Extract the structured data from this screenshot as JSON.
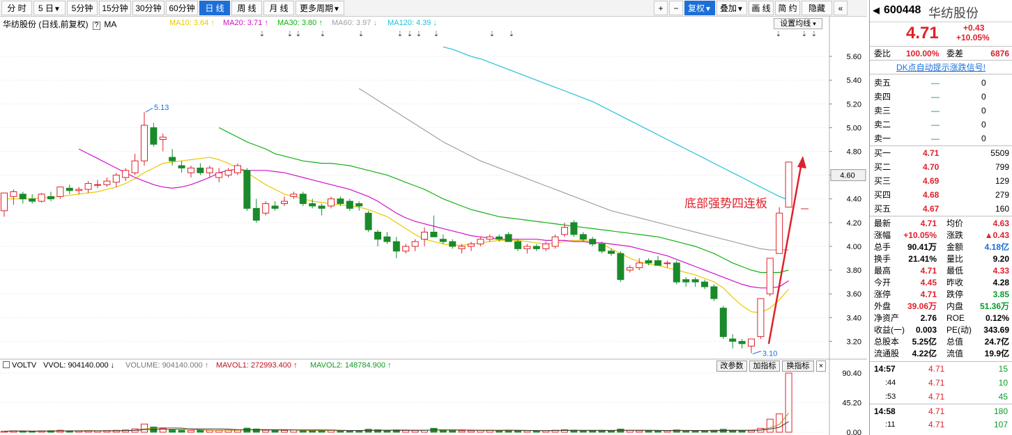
{
  "toolbar": {
    "left_buttons": [
      {
        "label": "分 时",
        "active": false
      },
      {
        "label": "5 日",
        "caret": true,
        "active": false
      },
      {
        "label": "5分钟",
        "active": false
      },
      {
        "label": "15分钟",
        "active": false
      },
      {
        "label": "30分钟",
        "active": false
      },
      {
        "label": "60分钟",
        "active": false
      },
      {
        "label": "日 线",
        "active": true
      },
      {
        "label": "周 线",
        "active": false
      },
      {
        "label": "月 线",
        "active": false
      },
      {
        "label": "更多周期",
        "caret": true,
        "active": false
      }
    ],
    "right_buttons": [
      {
        "label": "+",
        "active": false
      },
      {
        "label": "−",
        "active": false
      },
      {
        "label": "复权",
        "caret": true,
        "active": true
      },
      {
        "label": "叠加",
        "caret": true,
        "active": false
      },
      {
        "label": "画 线",
        "active": false
      },
      {
        "label": "简 约",
        "active": false
      },
      {
        "label": "隐藏",
        "active": false
      },
      {
        "label": "«",
        "active": false
      }
    ]
  },
  "chart": {
    "title": "华纺股份 (日线,前复权)",
    "help": "?",
    "ma_label": "MA",
    "ma_legend": [
      {
        "text": "MA10: 3.64 ↑",
        "color": "#e8c800"
      },
      {
        "text": "MA20: 3.71 ↑",
        "color": "#d010c8"
      },
      {
        "text": "MA30: 3.80 ↑",
        "color": "#10b010"
      },
      {
        "text": "MA60: 3.97 ↓",
        "color": "#a0a0a0"
      },
      {
        "text": "MA120: 4.39 ↓",
        "color": "#20c0d8"
      }
    ],
    "set_ma": "设置均线",
    "annotation": "底部强势四连板",
    "high_label": "5.13",
    "low_label": "3.10",
    "price_tag": "4.60",
    "y_ticks": [
      "5.60",
      "5.40",
      "5.20",
      "5.00",
      "4.80",
      "4.60",
      "4.40",
      "4.20",
      "4.00",
      "3.80",
      "3.60",
      "3.40",
      "3.20"
    ],
    "vol_ticks": [
      "90.40",
      "45.20",
      "0.00"
    ]
  },
  "chart_data": {
    "type": "candlestick",
    "ylim": [
      3.05,
      5.7
    ],
    "candles": [
      [
        4.3,
        4.45,
        4.25,
        4.45
      ],
      [
        4.42,
        4.48,
        4.35,
        4.46
      ],
      [
        4.44,
        4.46,
        4.36,
        4.4
      ],
      [
        4.4,
        4.44,
        4.36,
        4.38
      ],
      [
        4.38,
        4.45,
        4.37,
        4.44
      ],
      [
        4.42,
        4.46,
        4.38,
        4.4
      ],
      [
        4.42,
        4.5,
        4.4,
        4.5
      ],
      [
        4.49,
        4.52,
        4.44,
        4.47
      ],
      [
        4.47,
        4.5,
        4.44,
        4.48
      ],
      [
        4.48,
        4.55,
        4.45,
        4.53
      ],
      [
        4.52,
        4.56,
        4.49,
        4.52
      ],
      [
        4.52,
        4.58,
        4.5,
        4.55
      ],
      [
        4.54,
        4.62,
        4.5,
        4.6
      ],
      [
        4.58,
        4.66,
        4.55,
        4.64
      ],
      [
        4.62,
        4.78,
        4.6,
        4.72
      ],
      [
        4.72,
        5.13,
        4.68,
        5.02
      ],
      [
        5.0,
        5.04,
        4.84,
        4.86
      ],
      [
        4.9,
        4.95,
        4.8,
        4.92
      ],
      [
        4.75,
        4.82,
        4.68,
        4.72
      ],
      [
        4.68,
        4.72,
        4.62,
        4.66
      ],
      [
        4.62,
        4.68,
        4.58,
        4.66
      ],
      [
        4.66,
        4.7,
        4.6,
        4.62
      ],
      [
        4.62,
        4.68,
        4.58,
        4.66
      ],
      [
        4.58,
        4.66,
        4.54,
        4.62
      ],
      [
        4.6,
        4.66,
        4.58,
        4.64
      ],
      [
        4.62,
        4.7,
        4.6,
        4.68
      ],
      [
        4.64,
        4.66,
        4.3,
        4.32
      ],
      [
        4.32,
        4.4,
        4.2,
        4.22
      ],
      [
        4.28,
        4.38,
        4.26,
        4.36
      ],
      [
        4.34,
        4.38,
        4.3,
        4.32
      ],
      [
        4.36,
        4.42,
        4.34,
        4.38
      ],
      [
        4.42,
        4.46,
        4.4,
        4.44
      ],
      [
        4.44,
        4.46,
        4.34,
        4.36
      ],
      [
        4.36,
        4.4,
        4.32,
        4.34
      ],
      [
        4.34,
        4.36,
        4.26,
        4.32
      ],
      [
        4.34,
        4.42,
        4.32,
        4.4
      ],
      [
        4.4,
        4.42,
        4.34,
        4.36
      ],
      [
        4.38,
        4.4,
        4.3,
        4.32
      ],
      [
        4.36,
        4.38,
        4.3,
        4.34
      ],
      [
        4.28,
        4.3,
        4.12,
        4.14
      ],
      [
        4.12,
        4.14,
        4.0,
        4.06
      ],
      [
        4.08,
        4.12,
        4.02,
        4.04
      ],
      [
        4.04,
        4.08,
        3.9,
        3.96
      ],
      [
        3.96,
        4.02,
        3.94,
        4.0
      ],
      [
        4.0,
        4.06,
        3.96,
        4.04
      ],
      [
        4.06,
        4.16,
        4.0,
        4.12
      ],
      [
        4.12,
        4.26,
        4.1,
        4.08
      ],
      [
        4.06,
        4.1,
        4.02,
        4.04
      ],
      [
        4.04,
        4.06,
        3.98,
        4.0
      ],
      [
        3.98,
        4.02,
        3.94,
        4.0
      ],
      [
        4.0,
        4.04,
        3.96,
        4.02
      ],
      [
        4.02,
        4.08,
        4.0,
        4.06
      ],
      [
        4.06,
        4.1,
        4.04,
        4.08
      ],
      [
        4.08,
        4.1,
        4.04,
        4.06
      ],
      [
        4.1,
        4.12,
        4.04,
        4.04
      ],
      [
        4.04,
        4.06,
        3.96,
        3.98
      ],
      [
        3.98,
        4.02,
        3.94,
        4.0
      ],
      [
        4.0,
        4.02,
        3.96,
        3.98
      ],
      [
        3.98,
        4.04,
        3.96,
        4.02
      ],
      [
        4.0,
        4.1,
        3.98,
        4.08
      ],
      [
        4.1,
        4.2,
        4.08,
        4.16
      ],
      [
        4.2,
        4.22,
        4.08,
        4.1
      ],
      [
        4.1,
        4.12,
        4.04,
        4.06
      ],
      [
        4.06,
        4.08,
        4.0,
        4.02
      ],
      [
        4.02,
        4.04,
        3.94,
        3.96
      ],
      [
        3.96,
        3.98,
        3.92,
        3.94
      ],
      [
        3.94,
        3.96,
        3.7,
        3.72
      ],
      [
        3.8,
        3.84,
        3.78,
        3.82
      ],
      [
        3.82,
        3.9,
        3.8,
        3.86
      ],
      [
        3.88,
        3.9,
        3.84,
        3.86
      ],
      [
        3.88,
        3.92,
        3.84,
        3.84
      ],
      [
        3.86,
        3.88,
        3.82,
        3.86
      ],
      [
        3.86,
        3.88,
        3.68,
        3.7
      ],
      [
        3.72,
        3.74,
        3.66,
        3.7
      ],
      [
        3.72,
        3.74,
        3.66,
        3.7
      ],
      [
        3.7,
        3.72,
        3.64,
        3.66
      ],
      [
        3.66,
        3.68,
        3.54,
        3.56
      ],
      [
        3.48,
        3.5,
        3.22,
        3.24
      ],
      [
        3.22,
        3.26,
        3.14,
        3.2
      ],
      [
        3.2,
        3.22,
        3.14,
        3.18
      ],
      [
        3.16,
        3.22,
        3.1,
        3.22
      ],
      [
        3.24,
        3.56,
        3.22,
        3.56
      ],
      [
        3.6,
        3.9,
        3.58,
        3.9
      ],
      [
        3.94,
        4.33,
        3.94,
        4.28
      ],
      [
        4.33,
        4.71,
        4.33,
        4.71
      ]
    ],
    "ma": [
      {
        "name": "MA10",
        "color": "#e8c800",
        "values": [
          4.4,
          4.4,
          4.4,
          4.4,
          4.41,
          4.41,
          4.42,
          4.43,
          4.44,
          4.45,
          4.46,
          4.48,
          4.5,
          4.53,
          4.57,
          4.62,
          4.66,
          4.7,
          4.71,
          4.72,
          4.73,
          4.74,
          4.75,
          4.73,
          4.7,
          4.66,
          4.62,
          4.57,
          4.52,
          4.48,
          4.44,
          4.42,
          4.4,
          4.38,
          4.37,
          4.36,
          4.35,
          4.34,
          4.33,
          4.31,
          4.28,
          4.25,
          4.2,
          4.15,
          4.1,
          4.06,
          4.04,
          4.02,
          4.01,
          4.01,
          4.02,
          4.03,
          4.04,
          4.05,
          4.05,
          4.05,
          4.04,
          4.03,
          4.02,
          4.03,
          4.04,
          4.05,
          4.05,
          4.04,
          4.02,
          3.98,
          3.94,
          3.9,
          3.87,
          3.85,
          3.84,
          3.82,
          3.8,
          3.78,
          3.76,
          3.73,
          3.7,
          3.65,
          3.57,
          3.5,
          3.45,
          3.44,
          3.48,
          3.55,
          3.64
        ]
      },
      {
        "name": "MA20",
        "color": "#d010c8",
        "values": [
          4.82,
          4.78,
          4.74,
          4.7,
          4.66,
          4.62,
          4.58,
          4.55,
          4.52,
          4.5,
          4.49,
          4.5,
          4.52,
          4.55,
          4.58,
          4.62,
          4.64,
          4.65,
          4.64,
          4.64,
          4.64,
          4.63,
          4.62,
          4.6,
          4.58,
          4.56,
          4.54,
          4.52,
          4.5,
          4.48,
          4.45,
          4.42,
          4.38,
          4.33,
          4.28,
          4.24,
          4.21,
          4.19,
          4.17,
          4.15,
          4.13,
          4.11,
          4.09,
          4.08,
          4.07,
          4.06,
          4.06,
          4.06,
          4.06,
          4.06,
          4.05,
          4.05,
          4.05,
          4.04,
          4.04,
          4.03,
          4.03,
          4.02,
          4.01,
          4.0,
          3.98,
          3.96,
          3.94,
          3.92,
          3.89,
          3.86,
          3.83,
          3.8,
          3.77,
          3.74,
          3.71,
          3.68,
          3.66,
          3.65,
          3.65,
          3.66,
          3.71
        ]
      },
      {
        "name": "MA30",
        "color": "#10b010",
        "values": [
          5.0,
          4.96,
          4.92,
          4.88,
          4.85,
          4.82,
          4.78,
          4.76,
          4.74,
          4.72,
          4.71,
          4.7,
          4.7,
          4.69,
          4.68,
          4.66,
          4.64,
          4.62,
          4.6,
          4.57,
          4.54,
          4.51,
          4.48,
          4.44,
          4.4,
          4.37,
          4.34,
          4.31,
          4.29,
          4.27,
          4.25,
          4.24,
          4.23,
          4.22,
          4.21,
          4.2,
          4.19,
          4.18,
          4.17,
          4.16,
          4.15,
          4.14,
          4.13,
          4.12,
          4.11,
          4.1,
          4.09,
          4.08,
          4.06,
          4.04,
          4.02,
          4.0,
          3.97,
          3.94,
          3.9,
          3.86,
          3.83,
          3.8,
          3.78,
          3.78,
          3.78,
          3.8
        ]
      },
      {
        "name": "MA60",
        "color": "#a0a0a0",
        "values": [
          5.33,
          5.28,
          5.23,
          5.18,
          5.13,
          5.08,
          5.03,
          4.98,
          4.93,
          4.88,
          4.84,
          4.8,
          4.76,
          4.72,
          4.69,
          4.66,
          4.63,
          4.6,
          4.57,
          4.54,
          4.51,
          4.48,
          4.45,
          4.42,
          4.39,
          4.36,
          4.33,
          4.3,
          4.28,
          4.26,
          4.24,
          4.22,
          4.2,
          4.18,
          4.16,
          4.14,
          4.12,
          4.1,
          4.08,
          4.06,
          4.04,
          4.02,
          4.0,
          3.98,
          3.97,
          3.97,
          3.97
        ]
      },
      {
        "name": "MA120",
        "color": "#20c0d8",
        "values": [
          5.68,
          5.66,
          5.63,
          5.6,
          5.58,
          5.55,
          5.52,
          5.49,
          5.46,
          5.43,
          5.4,
          5.37,
          5.34,
          5.31,
          5.28,
          5.25,
          5.22,
          5.18,
          5.14,
          5.1,
          5.06,
          5.02,
          4.98,
          4.94,
          4.9,
          4.86,
          4.82,
          4.78,
          4.74,
          4.7,
          4.66,
          4.62,
          4.58,
          4.54,
          4.5,
          4.46,
          4.42,
          4.39
        ]
      }
    ],
    "volume": {
      "ylim": [
        0,
        90.4
      ],
      "values": [
        1.5,
        2.1,
        1.8,
        1.2,
        2.0,
        2.3,
        3.0,
        2.2,
        1.9,
        2.5,
        2.1,
        2.6,
        2.9,
        3.4,
        5.2,
        12.5,
        8.0,
        6.0,
        3.5,
        3.0,
        2.8,
        3.2,
        2.9,
        2.7,
        3.1,
        3.5,
        6.2,
        5.0,
        3.0,
        2.5,
        2.8,
        3.3,
        2.9,
        2.4,
        2.6,
        2.8,
        2.5,
        2.2,
        2.3,
        4.5,
        3.8,
        3.0,
        3.5,
        2.8,
        2.5,
        3.2,
        6.0,
        3.1,
        2.4,
        2.2,
        2.3,
        2.6,
        3.0,
        2.8,
        3.2,
        2.5,
        2.3,
        2.2,
        2.4,
        3.0,
        3.8,
        3.2,
        2.6,
        2.4,
        2.8,
        2.5,
        4.8,
        2.6,
        2.3,
        2.1,
        2.2,
        2.0,
        3.5,
        2.6,
        2.4,
        2.2,
        3.0,
        4.5,
        3.2,
        2.6,
        2.4,
        6.0,
        20.0,
        28.0,
        90.4
      ]
    }
  },
  "volume_panel": {
    "label": "VOLTV",
    "vvol": "VVOL: 904140.000 ↓",
    "volume": "VOLUME: 904140.000 ↑",
    "mavol1": "MAVOL1: 272993.400 ↑",
    "mavol2": "MAVOL2: 148784.900 ↑",
    "btn_change_param": "改参数",
    "btn_add_indicator": "加指标",
    "btn_switch_indicator": "换指标",
    "close": "×"
  },
  "quote": {
    "code": "600448",
    "name": "华纺股份",
    "price": "4.71",
    "change": "+0.43",
    "change_pct": "+10.05%",
    "weibi_label": "委比",
    "weibi": "100.00%",
    "weicha_label": "委差",
    "weicha": "6876",
    "signal_link": "DK点自动提示涨跌信号!",
    "sells": [
      {
        "label": "卖五",
        "price": "—",
        "vol": "0"
      },
      {
        "label": "卖四",
        "price": "—",
        "vol": "0"
      },
      {
        "label": "卖三",
        "price": "—",
        "vol": "0"
      },
      {
        "label": "卖二",
        "price": "—",
        "vol": "0"
      },
      {
        "label": "卖一",
        "price": "—",
        "vol": "0"
      }
    ],
    "buys": [
      {
        "label": "买一",
        "price": "4.71",
        "vol": "5509"
      },
      {
        "label": "买二",
        "price": "4.70",
        "vol": "799"
      },
      {
        "label": "买三",
        "price": "4.69",
        "vol": "129"
      },
      {
        "label": "买四",
        "price": "4.68",
        "vol": "279"
      },
      {
        "label": "买五",
        "price": "4.67",
        "vol": "160"
      }
    ],
    "stats": [
      [
        {
          "l": "最新",
          "v": "4.71",
          "c": "red"
        },
        {
          "l": "均价",
          "v": "4.63",
          "c": "red"
        }
      ],
      [
        {
          "l": "涨幅",
          "v": "+10.05%",
          "c": "red"
        },
        {
          "l": "涨跌",
          "v": "▲0.43",
          "c": "red"
        }
      ],
      [
        {
          "l": "总手",
          "v": "90.41万",
          "c": ""
        },
        {
          "l": "金额",
          "v": "4.18亿",
          "c": "blue"
        }
      ],
      [
        {
          "l": "换手",
          "v": "21.41%",
          "c": ""
        },
        {
          "l": "量比",
          "v": "9.20",
          "c": ""
        }
      ],
      [
        {
          "l": "最高",
          "v": "4.71",
          "c": "red"
        },
        {
          "l": "最低",
          "v": "4.33",
          "c": "red"
        }
      ],
      [
        {
          "l": "今开",
          "v": "4.45",
          "c": "red"
        },
        {
          "l": "昨收",
          "v": "4.28",
          "c": ""
        }
      ],
      [
        {
          "l": "涨停",
          "v": "4.71",
          "c": "red"
        },
        {
          "l": "跌停",
          "v": "3.85",
          "c": "green"
        }
      ],
      [
        {
          "l": "外盘",
          "v": "39.06万",
          "c": "red"
        },
        {
          "l": "内盘",
          "v": "51.36万",
          "c": "green"
        }
      ],
      [
        {
          "l": "净资产",
          "v": "2.76",
          "c": ""
        },
        {
          "l": "ROE",
          "v": "0.12%",
          "c": ""
        }
      ],
      [
        {
          "l": "收益(一)",
          "v": "0.003",
          "c": ""
        },
        {
          "l": "PE(动)",
          "v": "343.69",
          "c": ""
        }
      ],
      [
        {
          "l": "总股本",
          "v": "5.25亿",
          "c": ""
        },
        {
          "l": "总值",
          "v": "24.7亿",
          "c": ""
        }
      ],
      [
        {
          "l": "流通股",
          "v": "4.22亿",
          "c": ""
        },
        {
          "l": "流值",
          "v": "19.9亿",
          "c": ""
        }
      ]
    ],
    "ticks": [
      {
        "time": "14:57",
        "price": "4.71",
        "vol": "15",
        "major": true
      },
      {
        "time": ":44",
        "price": "4.71",
        "vol": "10",
        "major": false
      },
      {
        "time": ":53",
        "price": "4.71",
        "vol": "45",
        "major": false
      },
      {
        "time": "14:58",
        "price": "4.71",
        "vol": "180",
        "major": true
      },
      {
        "time": ":11",
        "price": "4.71",
        "vol": "107",
        "major": false
      }
    ]
  }
}
